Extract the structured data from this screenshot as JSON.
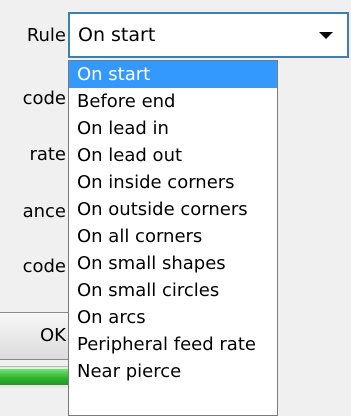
{
  "labels": {
    "rule": "Rule",
    "code_1": "code",
    "rate": "rate",
    "distance_partial": "ance",
    "code_2": "code"
  },
  "rule_dropdown": {
    "selected": "On start",
    "options": [
      "On start",
      "Before end",
      "On lead in",
      "On lead out",
      "On inside corners",
      "On outside corners",
      "On all corners",
      "On small shapes",
      "On small circles",
      "On arcs",
      "Peripheral feed rate",
      "Near pierce"
    ],
    "highlighted_index": 0
  },
  "ok_button": {
    "label": "OK"
  },
  "progress": {
    "fraction": 1.0
  },
  "colors": {
    "selection": "#3399ff",
    "combo_border": "#3c7fb1",
    "progress_green": "#2fb52f",
    "dialog_bg": "#f0f0f0"
  },
  "icons": {
    "dropdown_arrow": "chevron-down-icon"
  }
}
